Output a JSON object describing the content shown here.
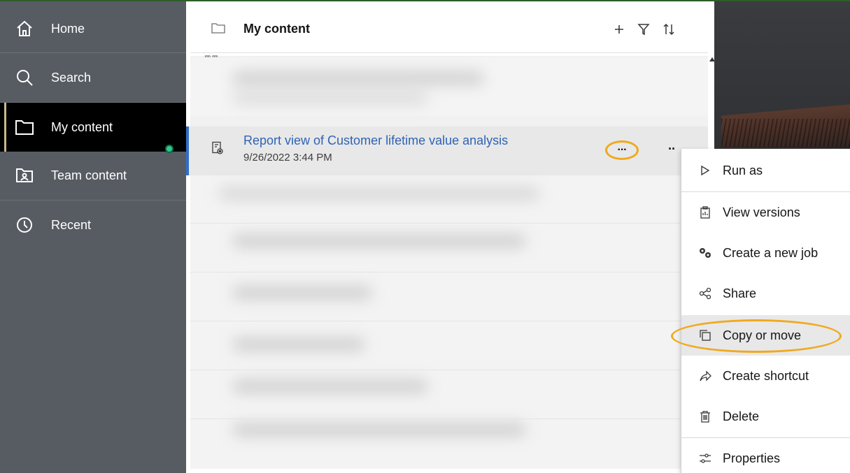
{
  "sidebar": {
    "items": [
      {
        "label": "Home",
        "icon": "home-icon"
      },
      {
        "label": "Search",
        "icon": "search-icon"
      },
      {
        "label": "My content",
        "icon": "folder-icon",
        "active": true
      },
      {
        "label": "Team content",
        "icon": "team-folder-icon"
      },
      {
        "label": "Recent",
        "icon": "clock-icon"
      }
    ]
  },
  "header": {
    "title": "My content",
    "actions": [
      "add",
      "filter",
      "sort"
    ]
  },
  "item": {
    "title": "Report view of Customer lifetime value analysis",
    "date": "9/26/2022 3:44 PM",
    "more_label": "···",
    "more_label_2": "··"
  },
  "menu": {
    "items": [
      {
        "label": "Run as",
        "icon": "play-icon"
      },
      {
        "label": "View versions",
        "icon": "versions-icon"
      },
      {
        "label": "Create a new job",
        "icon": "gears-icon"
      },
      {
        "label": "Share",
        "icon": "share-icon"
      },
      {
        "label": "Copy or move",
        "icon": "copy-icon"
      },
      {
        "label": "Create shortcut",
        "icon": "shortcut-icon"
      },
      {
        "label": "Delete",
        "icon": "trash-icon"
      },
      {
        "label": "Properties",
        "icon": "sliders-icon"
      }
    ]
  },
  "colors": {
    "sidebar_bg": "#575c63",
    "active_bg": "#000000",
    "link": "#2f63b5",
    "highlight_ring": "#f0a91f",
    "status_dot": "#2fc98f"
  }
}
